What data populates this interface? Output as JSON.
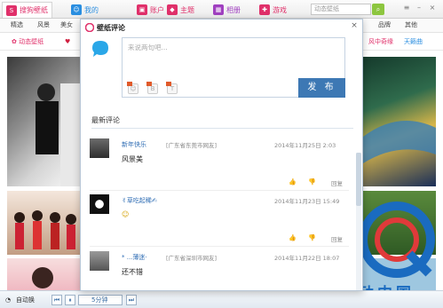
{
  "topbar": {
    "tabs": [
      {
        "label": "搜狗壁纸",
        "color": "#e0306a"
      },
      {
        "label": "我的",
        "color": "#2a8ee0"
      },
      {
        "label": "账户",
        "color": "#e0306a"
      },
      {
        "label": "主题",
        "color": "#e0306a"
      },
      {
        "label": "相册",
        "color": "#a040c0"
      },
      {
        "label": "游戏",
        "color": "#e0306a"
      }
    ],
    "search_placeholder": "动态壁纸"
  },
  "categories": [
    "精选",
    "风景",
    "美女",
    "品牌",
    "其他"
  ],
  "filters": {
    "dynamic": "动态壁纸",
    "right1": "风中奇缘",
    "right2": "天籁曲"
  },
  "dialog": {
    "title": "壁纸评论",
    "compose_placeholder": "来说两句吧...",
    "publish_label": "发 布",
    "latest_heading": "最新评论",
    "close_glyph": "×"
  },
  "comments": [
    {
      "name": "新年快乐",
      "location": "[广东省东莞市网友]",
      "time": "2014年11月25日 2:03",
      "text": "风景美",
      "reply": "回复"
    },
    {
      "name": "✌︎草吃起稀✍",
      "location": "",
      "time": "2014年11月23日 15:49",
      "text": "☺",
      "reply": "回复"
    },
    {
      "name": "* ...薄迷·",
      "location": "[广东省深圳市网友]",
      "time": "2014年11月22日 18:07",
      "text": "还不错",
      "reply": "回复"
    }
  ],
  "bottombar": {
    "auto_switch": "自动换",
    "speed": "5分钟"
  },
  "brand": {
    "text": "驱动中国"
  },
  "colors": {
    "accent": "#e0306a",
    "publish": "#3d78b4",
    "link": "#2f6db4"
  }
}
